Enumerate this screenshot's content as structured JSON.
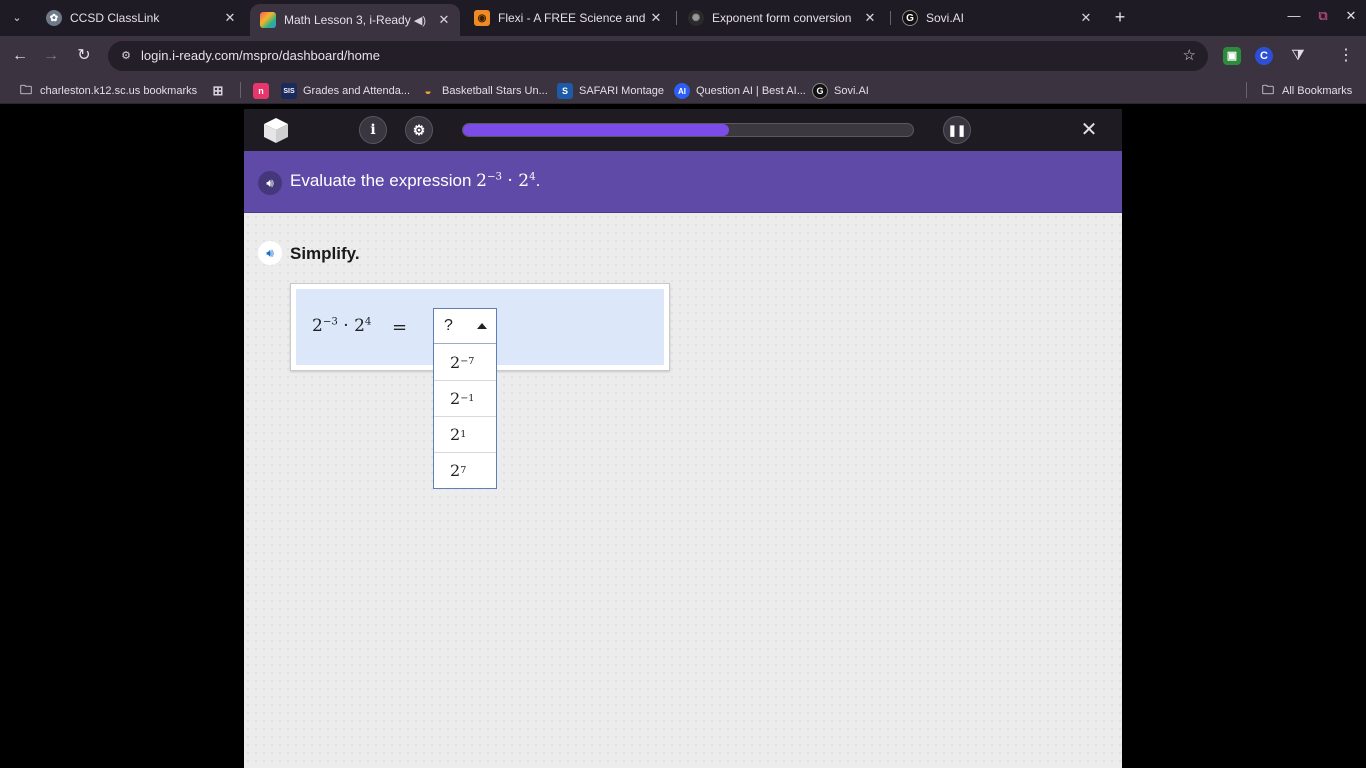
{
  "browser": {
    "tabs": [
      {
        "title": "CCSD ClassLink",
        "icon": "classlink-icon",
        "active": false
      },
      {
        "title": "Math Lesson 3, i-Ready",
        "icon": "iready-icon",
        "active": true,
        "audio": true
      },
      {
        "title": "Flexi - A FREE Science and Mat",
        "icon": "flexi-icon",
        "active": false
      },
      {
        "title": "Exponent form conversion",
        "icon": "openai-icon",
        "active": false
      },
      {
        "title": "Sovi.AI",
        "icon": "sovi-icon",
        "active": false
      }
    ],
    "url": "login.i-ready.com/mspro/dashboard/home",
    "extensions": [
      {
        "label": "▣",
        "color": "#2e8b3e"
      },
      {
        "label": "C",
        "color": "#2c4fd6"
      }
    ],
    "bookmarks": [
      {
        "label": "charleston.k12.sc.us bookmarks",
        "icon": "folder-icon"
      },
      {
        "label": "",
        "icon": "apps-grid-icon"
      },
      {
        "label": "",
        "icon": "n-app-icon"
      },
      {
        "label": "Grades and Attenda...",
        "icon": "sis-icon",
        "badge": "SIS"
      },
      {
        "label": "Basketball Stars Un...",
        "icon": "basketball-icon"
      },
      {
        "label": "SAFARI Montage",
        "icon": "safari-montage-icon"
      },
      {
        "label": "Question AI | Best AI...",
        "icon": "question-ai-icon",
        "badge": "AI"
      },
      {
        "label": "Sovi.AI",
        "icon": "sovi-icon"
      }
    ],
    "all_bookmarks": "All Bookmarks"
  },
  "lesson": {
    "progress_percent": 59,
    "prompt": {
      "lead": "Evaluate the expression ",
      "base1": "2",
      "exp1": "−3",
      "dot": " · ",
      "base2": "2",
      "exp2": "4",
      "end": "."
    },
    "instruction": "Simplify.",
    "expression": {
      "base1": "2",
      "exp1": "−3",
      "dot": " · ",
      "base2": "2",
      "exp2": "4"
    },
    "equals": "=",
    "dropdown": {
      "selected": "?",
      "options": [
        {
          "base": "2",
          "exp": "−7"
        },
        {
          "base": "2",
          "exp": "−1"
        },
        {
          "base": "2",
          "exp": "1"
        },
        {
          "base": "2",
          "exp": "7"
        }
      ]
    }
  },
  "colors": {
    "accent_purple": "#5f4ba7",
    "progress": "#7c4ce8",
    "work_area": "#dce8fa"
  }
}
